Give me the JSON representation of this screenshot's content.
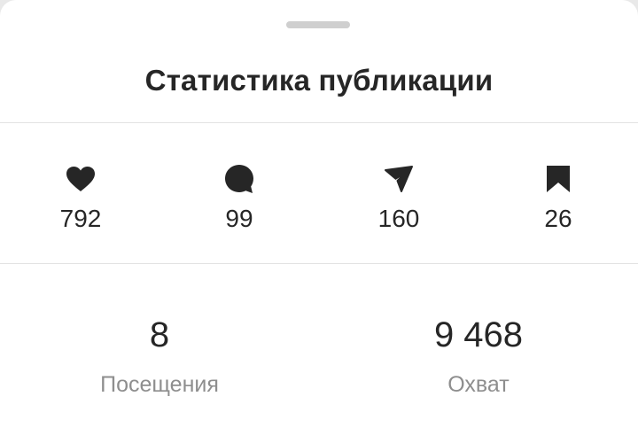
{
  "sheet": {
    "title": "Статистика публикации"
  },
  "interactions": [
    {
      "icon": "heart-icon",
      "value": "792"
    },
    {
      "icon": "comment-bubble-icon",
      "value": "99"
    },
    {
      "icon": "share-send-icon",
      "value": "160"
    },
    {
      "icon": "bookmark-icon",
      "value": "26"
    }
  ],
  "stats": [
    {
      "value": "8",
      "label": "Посещения"
    },
    {
      "value": "9 468",
      "label": "Охват"
    }
  ],
  "colors": {
    "text": "#262626",
    "secondary_text": "#8e8e8e",
    "divider": "#e2e2e2",
    "grabber": "#cfcfcf",
    "background": "#ffffff"
  }
}
